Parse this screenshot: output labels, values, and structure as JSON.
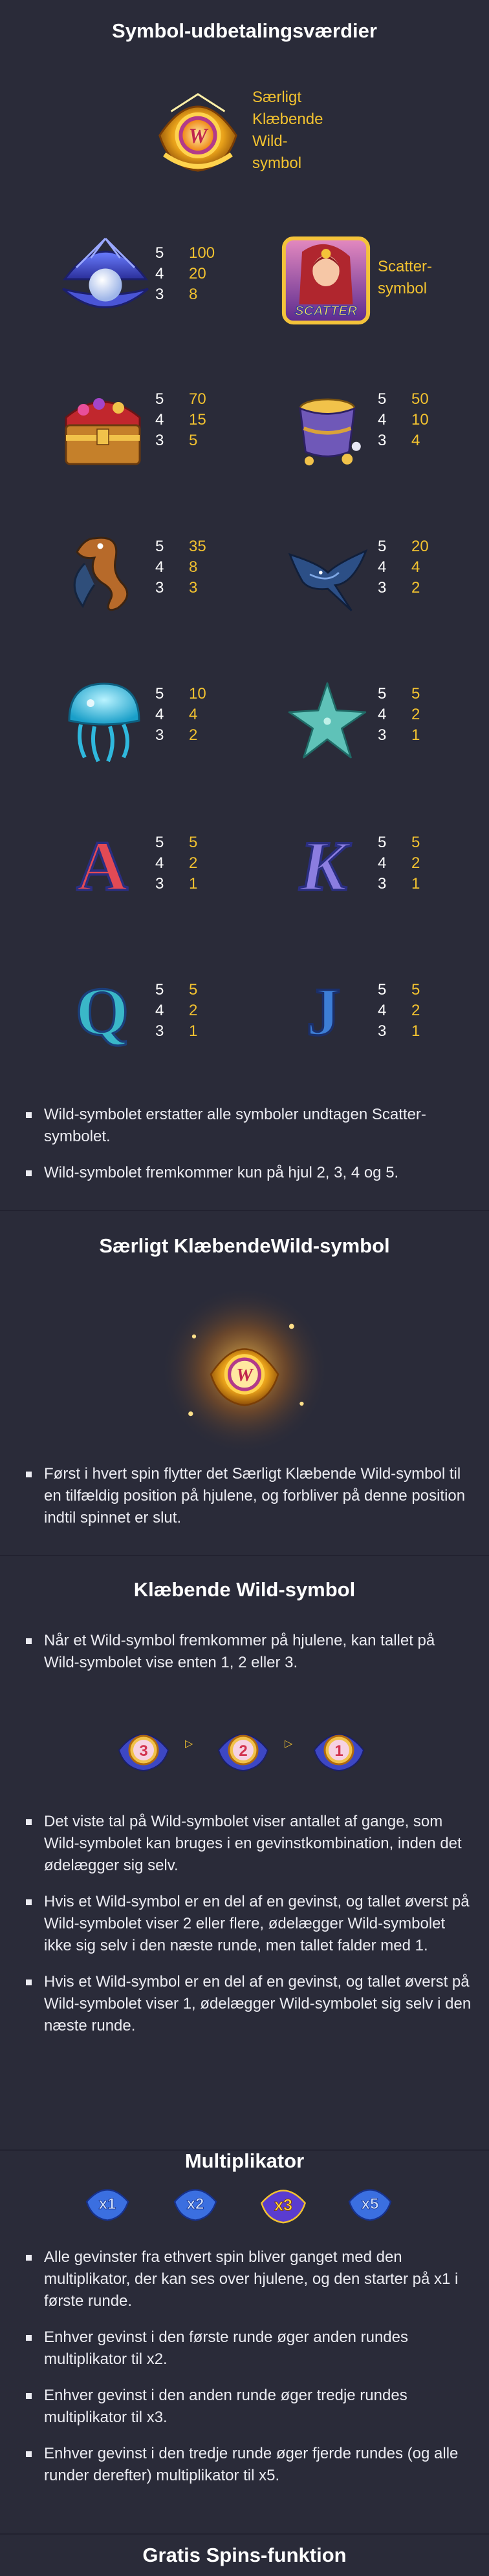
{
  "payout": {
    "title": "Symbol-udbetalingsværdier",
    "wild_label": "Særligt Klæbende Wild-symbol",
    "wild_label_lines": [
      "Særligt",
      "Klæbende",
      "Wild-",
      "symbol"
    ],
    "scatter_label_lines": [
      "Scatter-",
      "symbol"
    ],
    "scatter_icon_text": "SCATTER",
    "symbols": [
      {
        "name": "pearl-shell",
        "rows": [
          [
            "5",
            "100"
          ],
          [
            "4",
            "20"
          ],
          [
            "3",
            "8"
          ]
        ]
      },
      {
        "name": "treasure-chest",
        "rows": [
          [
            "5",
            "70"
          ],
          [
            "4",
            "15"
          ],
          [
            "3",
            "5"
          ]
        ]
      },
      {
        "name": "gold-bucket",
        "rows": [
          [
            "5",
            "50"
          ],
          [
            "4",
            "10"
          ],
          [
            "3",
            "4"
          ]
        ]
      },
      {
        "name": "seahorse",
        "rows": [
          [
            "5",
            "35"
          ],
          [
            "4",
            "8"
          ],
          [
            "3",
            "3"
          ]
        ]
      },
      {
        "name": "manta-ray",
        "rows": [
          [
            "5",
            "20"
          ],
          [
            "4",
            "4"
          ],
          [
            "3",
            "2"
          ]
        ]
      },
      {
        "name": "jellyfish",
        "rows": [
          [
            "5",
            "10"
          ],
          [
            "4",
            "4"
          ],
          [
            "3",
            "2"
          ]
        ]
      },
      {
        "name": "starfish",
        "rows": [
          [
            "5",
            "5"
          ],
          [
            "4",
            "2"
          ],
          [
            "3",
            "1"
          ]
        ]
      },
      {
        "name": "letter-a",
        "glyph": "A",
        "rows": [
          [
            "5",
            "5"
          ],
          [
            "4",
            "2"
          ],
          [
            "3",
            "1"
          ]
        ]
      },
      {
        "name": "letter-k",
        "glyph": "K",
        "rows": [
          [
            "5",
            "5"
          ],
          [
            "4",
            "2"
          ],
          [
            "3",
            "1"
          ]
        ]
      },
      {
        "name": "letter-q",
        "glyph": "Q",
        "rows": [
          [
            "5",
            "5"
          ],
          [
            "4",
            "2"
          ],
          [
            "3",
            "1"
          ]
        ]
      },
      {
        "name": "letter-j",
        "glyph": "J",
        "rows": [
          [
            "5",
            "5"
          ],
          [
            "4",
            "2"
          ],
          [
            "3",
            "1"
          ]
        ]
      }
    ],
    "wild_icon_letter": "W",
    "notes": [
      "Wild-symbolet erstatter alle symboler undtagen Scatter-symbolet.",
      "Wild-symbolet fremkommer kun på hjul 2, 3, 4 og 5."
    ]
  },
  "special_wild": {
    "title": "Særligt KlæbendeWild-symbol",
    "notes": [
      "Først i hvert spin flytter det Særligt Klæbende Wild-symbol til en tilfældig position på hjulene, og forbliver på denne position indtil spinnet er slut."
    ]
  },
  "sticky_wild": {
    "title": "Klæbende Wild-symbol",
    "intro": [
      "Når et Wild-symbol fremkommer på hjulene, kan tallet på Wild-symbolet vise enten 1, 2 eller 3."
    ],
    "counters": [
      "3",
      "2",
      "1"
    ],
    "notes": [
      "Det viste tal på Wild-symbolet viser antallet af gange, som Wild-symbolet kan bruges i en gevinstkombination, inden det ødelægger sig selv.",
      "Hvis et Wild-symbol er en del af en gevinst, og tallet øverst på Wild-symbolet viser 2 eller flere, ødelægger Wild-symbolet ikke sig selv i den næste runde, men tallet falder med 1.",
      "Hvis et Wild-symbol er en del af en gevinst, og tallet øverst på Wild-symbolet viser 1, ødelægger Wild-symbolet sig selv i den næste runde."
    ]
  },
  "multiplier": {
    "title": "Multiplikator",
    "badges": [
      "x1",
      "x2",
      "x3",
      "x5"
    ],
    "active_badge": "x3",
    "notes": [
      "Alle gevinster fra ethvert spin bliver ganget med den multiplikator, der kan ses over hjulene, og den starter på x1 i første runde.",
      "Enhver gevinst i den første runde øger anden rundes multiplikator til x2.",
      "Enhver gevinst i den anden runde øger tredje rundes multiplikator til x3.",
      "Enhver gevinst i den tredje runde øger fjerde rundes (og alle runder derefter) multiplikator til x5."
    ]
  },
  "free_spins": {
    "title": "Gratis Spins-funktion"
  },
  "colors": {
    "background": "#2a2b39",
    "accent_gold": "#f2c230",
    "text": "#ececf2"
  }
}
